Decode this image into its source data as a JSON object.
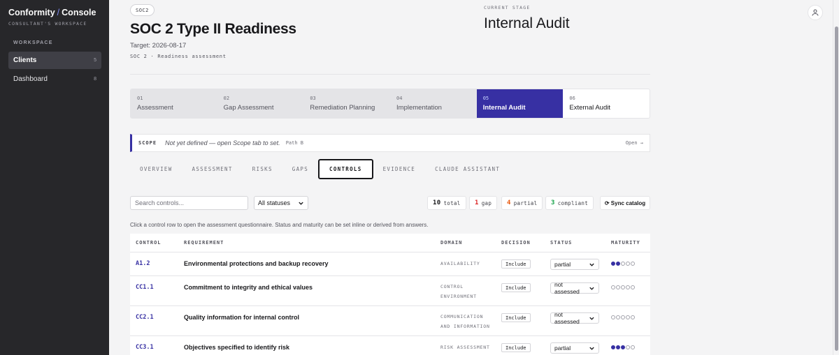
{
  "sidebar": {
    "brand_left": "Conformity",
    "brand_sep": "/",
    "brand_right": "Console",
    "workspace_owner": "CONSULTANT'S WORKSPACE",
    "workspace_heading": "WORKSPACE",
    "items": [
      {
        "label": "Clients",
        "count": "5",
        "active": true
      },
      {
        "label": "Dashboard",
        "count": "8",
        "active": false
      }
    ]
  },
  "header": {
    "badge": "SOC2",
    "title": "SOC 2 Type II Readiness",
    "target": "Target: 2026-08-17",
    "subline": "SOC 2 · Readiness assessment",
    "current_stage_label": "CURRENT STAGE",
    "current_stage": "Internal Audit",
    "avatar_icon": "user-icon"
  },
  "stepper": [
    {
      "num": "01",
      "label": "Assessment"
    },
    {
      "num": "02",
      "label": "Gap Assessment"
    },
    {
      "num": "03",
      "label": "Remediation Planning"
    },
    {
      "num": "04",
      "label": "Implementation"
    },
    {
      "num": "05",
      "label": "Internal Audit"
    },
    {
      "num": "06",
      "label": "External Audit"
    }
  ],
  "scope": {
    "key": "SCOPE",
    "value": "Not yet defined — open Scope tab to set.",
    "path": "Path B",
    "open": "Open →"
  },
  "tabs": [
    "OVERVIEW",
    "ASSESSMENT",
    "RISKS",
    "GAPS",
    "CONTROLS",
    "EVIDENCE",
    "CLAUDE ASSISTANT"
  ],
  "active_tab": "CONTROLS",
  "toolbar": {
    "search_placeholder": "Search controls...",
    "status_filter": "All statuses",
    "total_count": "10",
    "total_label": "total",
    "gap_count": "1",
    "gap_label": "gap",
    "partial_count": "4",
    "partial_label": "partial",
    "compliant_count": "3",
    "compliant_label": "compliant",
    "sync_label": "⟳ Sync catalog"
  },
  "hint": "Click a control row to open the assessment questionnaire. Status and maturity can be set inline or derived from answers.",
  "table": {
    "headers": [
      "CONTROL",
      "REQUIREMENT",
      "DOMAIN",
      "DECISION",
      "STATUS",
      "MATURITY"
    ],
    "rows": [
      {
        "id": "A1.2",
        "requirement": "Environmental protections and backup recovery",
        "domain": "AVAILABILITY",
        "decision": "Include",
        "status": "partial",
        "maturity": 2
      },
      {
        "id": "CC1.1",
        "requirement": "Commitment to integrity and ethical values",
        "domain": "CONTROL ENVIRONMENT",
        "decision": "Include",
        "status": "not assessed",
        "maturity": 0
      },
      {
        "id": "CC2.1",
        "requirement": "Quality information for internal control",
        "domain": "COMMUNICATION AND INFORMATION",
        "decision": "Include",
        "status": "not assessed",
        "maturity": 0
      },
      {
        "id": "CC3.1",
        "requirement": "Objectives specified to identify risk",
        "domain": "RISK ASSESSMENT",
        "decision": "Include",
        "status": "partial",
        "maturity": 3
      }
    ]
  },
  "colors": {
    "accent": "#3730a3",
    "sidebar_bg": "#27272a",
    "gap": "#dc2626",
    "partial": "#ea580c",
    "compliant": "#16a34a"
  }
}
